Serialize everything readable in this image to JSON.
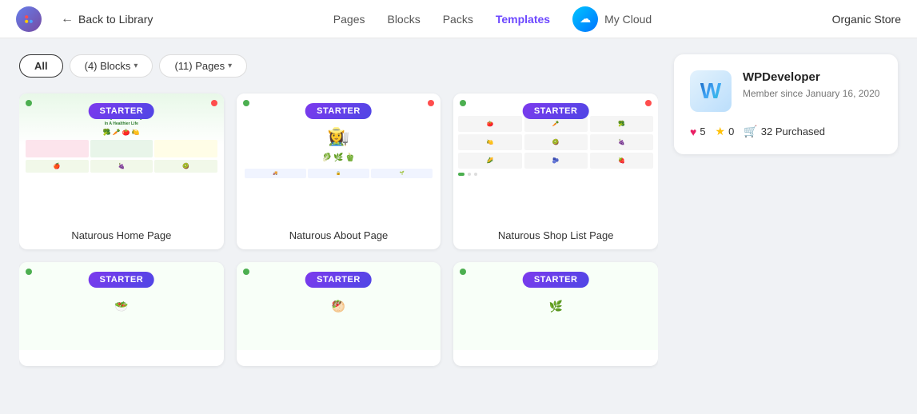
{
  "header": {
    "back_label": "Back to Library",
    "nav": [
      {
        "id": "pages",
        "label": "Pages",
        "active": false
      },
      {
        "id": "blocks",
        "label": "Blocks",
        "active": false
      },
      {
        "id": "packs",
        "label": "Packs",
        "active": false
      },
      {
        "id": "templates",
        "label": "Templates",
        "active": true
      },
      {
        "id": "my-cloud",
        "label": "My Cloud",
        "active": false
      }
    ],
    "site_name": "Organic Store"
  },
  "filters": {
    "all_label": "All",
    "blocks_label": "(4)  Blocks",
    "pages_label": "(11)  Pages"
  },
  "templates": [
    {
      "id": 1,
      "title": "Naturous Home Page",
      "badge": "STARTER"
    },
    {
      "id": 2,
      "title": "Naturous About Page",
      "badge": "STARTER"
    },
    {
      "id": 3,
      "title": "Naturous Shop List Page",
      "badge": "STARTER"
    },
    {
      "id": 4,
      "title": "",
      "badge": "STARTER"
    },
    {
      "id": 5,
      "title": "",
      "badge": "STARTER"
    },
    {
      "id": 6,
      "title": "",
      "badge": "STARTER"
    }
  ],
  "sidebar": {
    "author_initial": "W",
    "author_name": "WPDeveloper",
    "member_since": "Member since January 16, 2020",
    "likes": "5",
    "stars": "0",
    "purchased_label": "32 Purchased"
  }
}
